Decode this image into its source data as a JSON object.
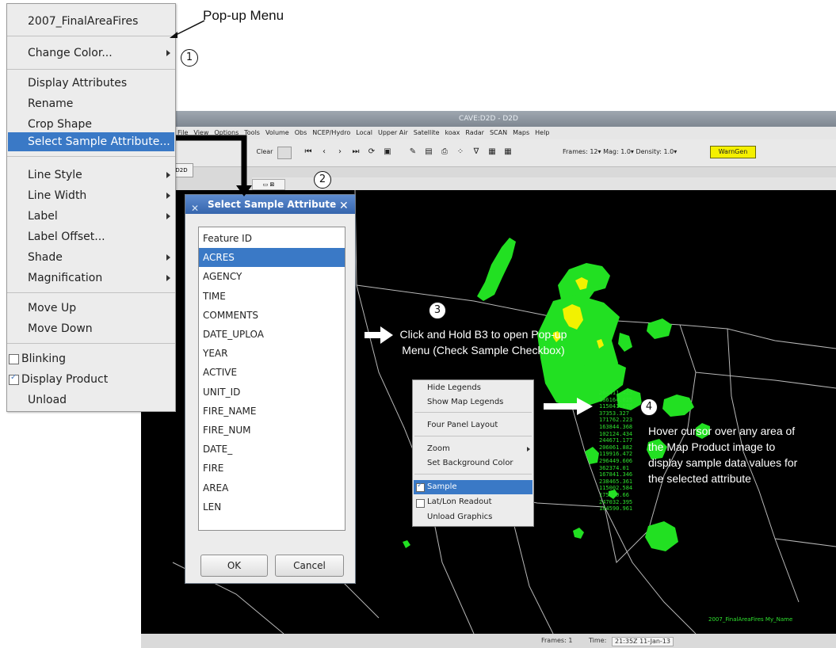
{
  "popup_annotation": "Pop-up Menu",
  "popup_menu": {
    "title": "2007_FinalAreaFires",
    "items": [
      "Change Color...",
      "Display Attributes",
      "Rename",
      "Crop Shape",
      "Select Sample Attribute...",
      "Line Style",
      "Line Width",
      "Label",
      "Label Offset...",
      "Shade",
      "Magnification",
      "Move Up",
      "Move Down",
      "Blinking",
      "Display Product",
      "Unload"
    ],
    "checkboxes": {
      "blinking": false,
      "display_product": true
    }
  },
  "callouts": [
    "1",
    "2",
    "3",
    "4"
  ],
  "cave": {
    "title": "CAVE:D2D - D2D",
    "menubar": [
      "File",
      "View",
      "Options",
      "Tools",
      "Volume",
      "Obs",
      "NCEP/Hydro",
      "Local",
      "Upper Air",
      "Satellite",
      "koax",
      "Radar",
      "SCAN",
      "Maps",
      "Help"
    ],
    "toolbar": {
      "clear": "Clear",
      "frames": "Frames: 12▾  Mag: 1.0▾  Density: 1.0▾",
      "warngen": "WarnGen"
    },
    "d2d_tab": "D2D",
    "legend": "2007_FinalAreaFires  My_Name",
    "status": {
      "frames_label": "Frames:  1",
      "time_label": "Time:",
      "time_value": "21:35Z 11-Jan-13"
    }
  },
  "dialog": {
    "title": "Select Sample Attribute",
    "list": [
      "Feature ID",
      "ACRES",
      "AGENCY",
      "TIME",
      "COMMENTS",
      "DATE_UPLOA",
      "YEAR",
      "ACTIVE",
      "UNIT_ID",
      "FIRE_NAME",
      "FIRE_NUM",
      "DATE_",
      "FIRE",
      "AREA",
      "LEN"
    ],
    "selected": "ACRES",
    "ok": "OK",
    "cancel": "Cancel"
  },
  "context_menu": {
    "items": [
      "Hide Legends",
      "Show Map Legends",
      "Four Panel Layout",
      "Zoom",
      "Set Background Color",
      "Sample",
      "Lat/Lon Readout",
      "Unload Graphics"
    ],
    "checked": {
      "sample": true,
      "lat_lon_readout": false
    }
  },
  "annotations": {
    "step3": "Click and Hold B3 to open Pop-up Menu (Check Sample Checkbox)",
    "step4": "Hover cursor over any area of the Map Product image to display sample data values for the selected attribute"
  },
  "sample_values": [
    "204411.429",
    "286164.025",
    "115041.678",
    "37353.327",
    "171762.223",
    "163844.368",
    "102124.434",
    "244671.177",
    "206061.882",
    "119916.472",
    "296449.606",
    "362374.01",
    "167841.346",
    "238465.361",
    "115002.584",
    "175690.66",
    "247032.395",
    "184590.961"
  ],
  "colors": {
    "selection": "#3a79c6",
    "fire_green": "#22e022",
    "fire_yellow": "#f2f200",
    "warngen": "#f5f000"
  }
}
